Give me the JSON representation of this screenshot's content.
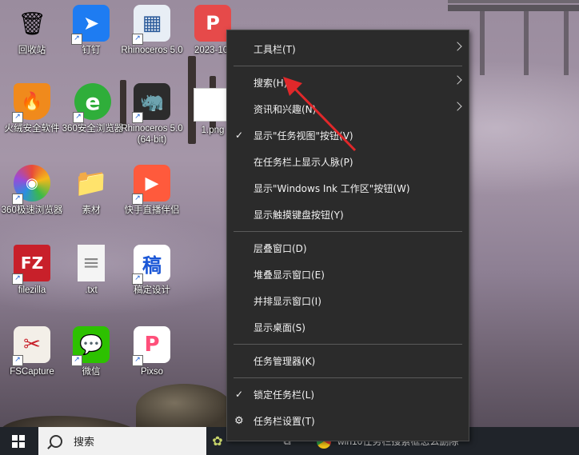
{
  "desktop": {
    "icons": [
      {
        "label": "回收站",
        "glyph": "🗑",
        "color": "#dfe6ee",
        "shortcut": false
      },
      {
        "label": "钉钉",
        "glyph": "➤",
        "color": "#1e7cf2",
        "shortcut": true
      },
      {
        "label": "Rhinoceros 5.0",
        "glyph": "▦",
        "color": "#e8eef5",
        "shortcut": true
      },
      {
        "label": "2023-10-",
        "glyph": "P",
        "color": "#e64a4a",
        "shortcut": false
      },
      {
        "label": "火绒安全软件",
        "glyph": "🔥",
        "color": "#f08a1c",
        "shortcut": true
      },
      {
        "label": "360安全浏览器",
        "glyph": "e",
        "color": "#2fae3a",
        "shortcut": true
      },
      {
        "label": "Rhinoceros 5.0 (64-bit)",
        "glyph": "🦏",
        "color": "#2c2c2c",
        "shortcut": true
      },
      {
        "label": "1.png",
        "glyph": "",
        "color": "#ffffff",
        "shortcut": false
      },
      {
        "label": "360极速浏览器",
        "glyph": "◉",
        "color": "#3aa0e8",
        "shortcut": true
      },
      {
        "label": "素材",
        "glyph": "📁",
        "color": "#e8c56a",
        "shortcut": false
      },
      {
        "label": "快手直播伴侣",
        "glyph": "▶",
        "color": "#ff5a3c",
        "shortcut": true
      },
      {
        "label": "filezilla",
        "glyph": "FZ",
        "color": "#c8202a",
        "shortcut": true
      },
      {
        "label": ".txt",
        "glyph": "≡",
        "color": "#f4f4f4",
        "shortcut": false
      },
      {
        "label": "稿定设计",
        "glyph": "稿",
        "color": "#ffffff",
        "shortcut": true
      },
      {
        "label": "FSCapture",
        "glyph": "✂",
        "color": "#2f8d3a",
        "shortcut": true
      },
      {
        "label": "微信",
        "glyph": "💬",
        "color": "#2dc100",
        "shortcut": true
      },
      {
        "label": "Pixso",
        "glyph": "P",
        "color": "#ff4f7a",
        "shortcut": true
      }
    ]
  },
  "taskbar": {
    "search_text": "搜索",
    "task_text": "win10任务栏搜索框怎么删除"
  },
  "context_menu": {
    "toolbar": "工具栏(T)",
    "search": "搜索(H)",
    "news": "资讯和兴趣(N)",
    "show_task_view": "显示\"任务视图\"按钮(V)",
    "show_people": "在任务栏上显示人脉(P)",
    "show_ink": "显示\"Windows Ink 工作区\"按钮(W)",
    "show_keyboard": "显示触摸键盘按钮(Y)",
    "cascade": "层叠窗口(D)",
    "stacked": "堆叠显示窗口(E)",
    "side_by_side": "并排显示窗口(I)",
    "show_desktop": "显示桌面(S)",
    "task_manager": "任务管理器(K)",
    "lock_taskbar": "锁定任务栏(L)",
    "taskbar_settings": "任务栏设置(T)"
  },
  "colors": {
    "arrow": "#e0282a",
    "menu_bg": "#2b2b2b"
  }
}
